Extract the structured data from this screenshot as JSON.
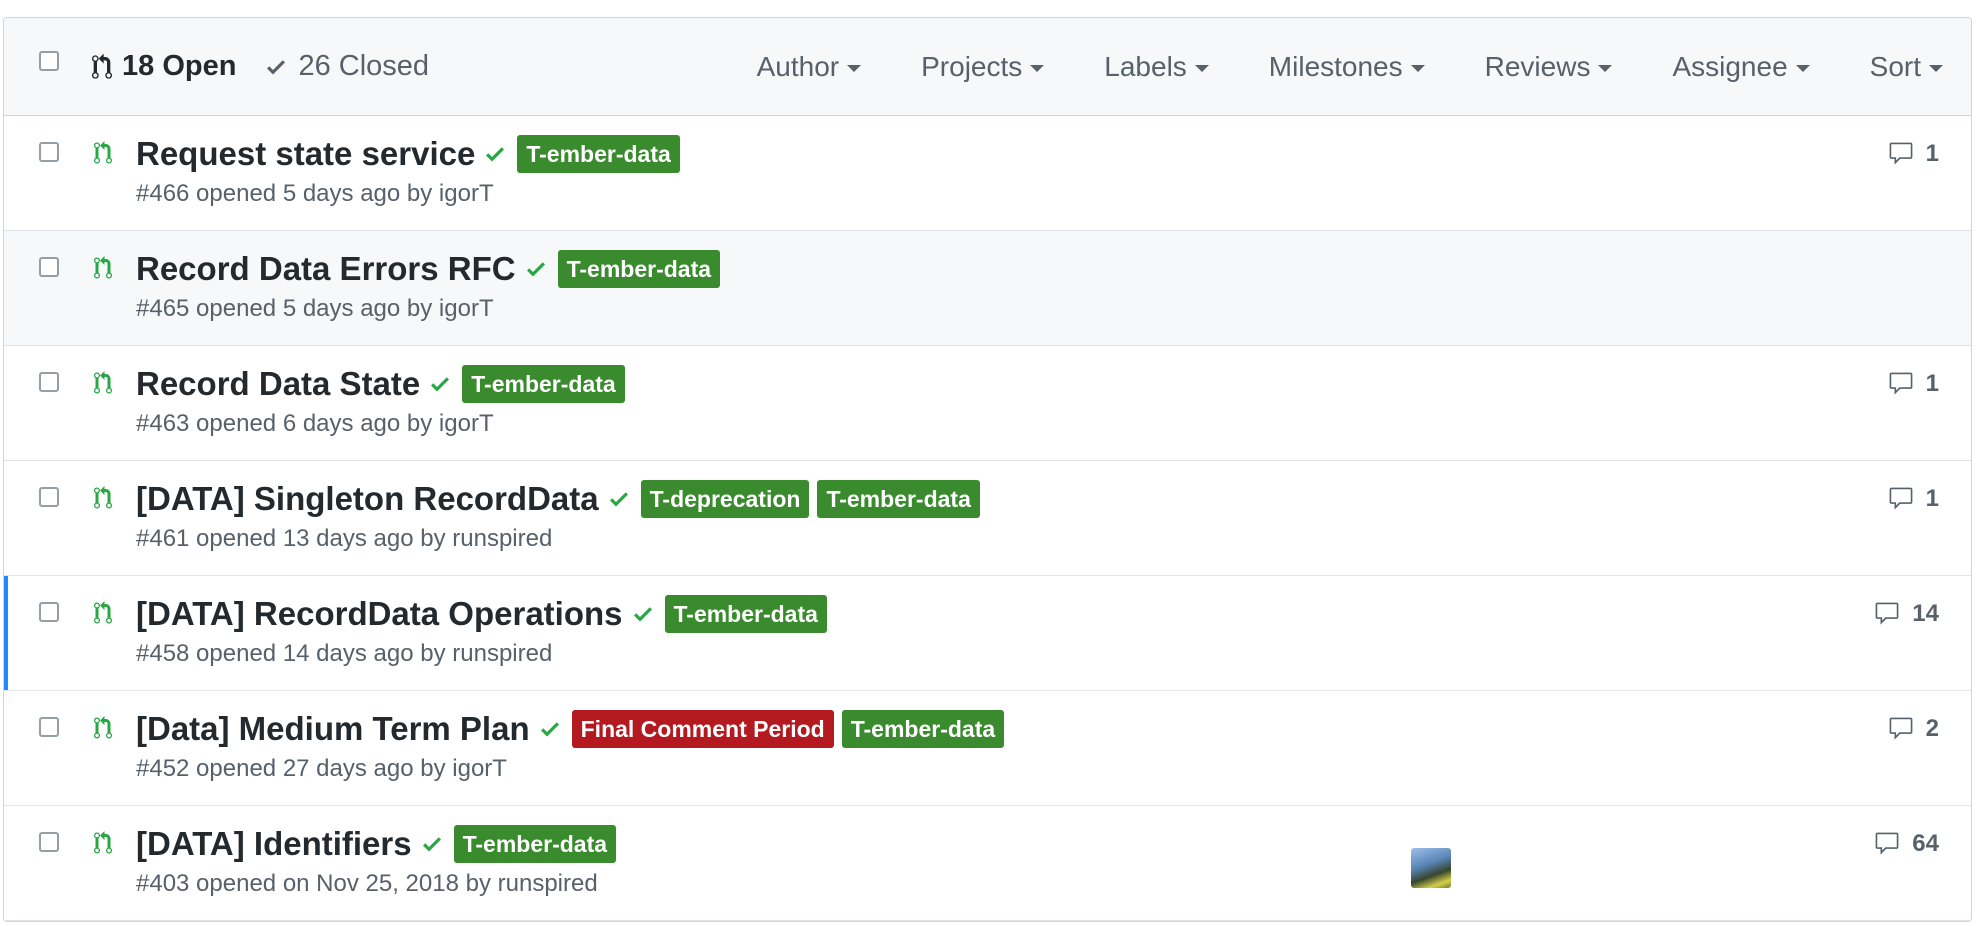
{
  "header": {
    "open_label": "18 Open",
    "closed_label": "26 Closed",
    "filters": [
      "Author",
      "Projects",
      "Labels",
      "Milestones",
      "Reviews",
      "Assignee",
      "Sort"
    ]
  },
  "colors": {
    "label_green": "#2e8b27",
    "label_red": "#b60205",
    "pr_open_green": "#28a745",
    "selection_blue": "#2188ff"
  },
  "pulls": [
    {
      "title": "Request state service",
      "labels": [
        {
          "text": "T-ember-data",
          "color": "#3a8a2e"
        }
      ],
      "meta": "#466 opened 5 days ago by igorT",
      "comments": "1"
    },
    {
      "title": "Record Data Errors RFC",
      "labels": [
        {
          "text": "T-ember-data",
          "color": "#3a8a2e"
        }
      ],
      "meta": "#465 opened 5 days ago by igorT",
      "comments": ""
    },
    {
      "title": "Record Data State",
      "labels": [
        {
          "text": "T-ember-data",
          "color": "#3a8a2e"
        }
      ],
      "meta": "#463 opened 6 days ago by igorT",
      "comments": "1"
    },
    {
      "title": "[DATA] Singleton RecordData",
      "labels": [
        {
          "text": "T-deprecation",
          "color": "#3a8a2e"
        },
        {
          "text": "T-ember-data",
          "color": "#3a8a2e"
        }
      ],
      "meta": "#461 opened 13 days ago by runspired",
      "comments": "1"
    },
    {
      "title": "[DATA] RecordData Operations",
      "labels": [
        {
          "text": "T-ember-data",
          "color": "#3a8a2e"
        }
      ],
      "meta": "#458 opened 14 days ago by runspired",
      "comments": "14"
    },
    {
      "title": "[Data] Medium Term Plan",
      "labels": [
        {
          "text": "Final Comment Period",
          "color": "#b3191f"
        },
        {
          "text": "T-ember-data",
          "color": "#3a8a2e"
        }
      ],
      "meta": "#452 opened 27 days ago by igorT",
      "comments": "2"
    },
    {
      "title": "[DATA] Identifiers",
      "labels": [
        {
          "text": "T-ember-data",
          "color": "#3a8a2e"
        }
      ],
      "meta": "#403 opened on Nov 25, 2018 by runspired",
      "comments": "64"
    }
  ]
}
